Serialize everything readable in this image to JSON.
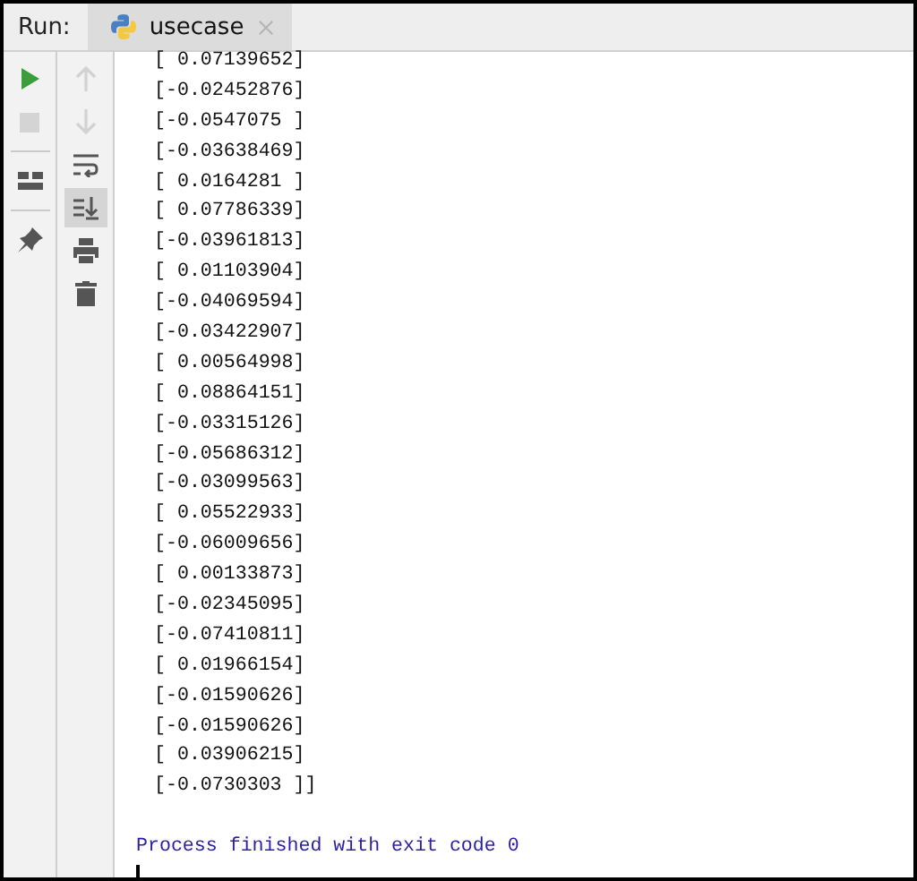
{
  "run_label": "Run:",
  "tabs": [
    {
      "label": "usecase",
      "selected": true
    }
  ],
  "toolbar_primary": [
    {
      "kind": "run",
      "disabled": false
    },
    {
      "kind": "stop",
      "disabled": true
    },
    {
      "kind": "separator"
    },
    {
      "kind": "layout",
      "disabled": false
    },
    {
      "kind": "separator"
    },
    {
      "kind": "pin",
      "disabled": false
    }
  ],
  "toolbar_secondary": [
    {
      "kind": "up",
      "disabled": true,
      "on": false
    },
    {
      "kind": "down",
      "disabled": true,
      "on": false
    },
    {
      "kind": "wrap",
      "disabled": false,
      "on": false
    },
    {
      "kind": "scroll-end",
      "disabled": false,
      "on": true
    },
    {
      "kind": "print",
      "disabled": false,
      "on": false
    },
    {
      "kind": "trash",
      "disabled": false,
      "on": false
    }
  ],
  "output_lines": [
    "[ 0.07139652]",
    "[-0.02452876]",
    "[-0.0547075 ]",
    "[-0.03638469]",
    "[ 0.0164281 ]",
    "[ 0.07786339]",
    "[-0.03961813]",
    "[ 0.01103904]",
    "[-0.04069594]",
    "[-0.03422907]",
    "[ 0.00564998]",
    "[ 0.08864151]",
    "[-0.03315126]",
    "[-0.05686312]",
    "[-0.03099563]",
    "[ 0.05522933]",
    "[-0.06009656]",
    "[ 0.00133873]",
    "[-0.02345095]",
    "[-0.07410811]",
    "[ 0.01966154]",
    "[-0.01590626]",
    "[-0.01590626]",
    "[ 0.03906215]",
    "[-0.0730303 ]]"
  ],
  "exit_message": "Process finished with exit code 0"
}
